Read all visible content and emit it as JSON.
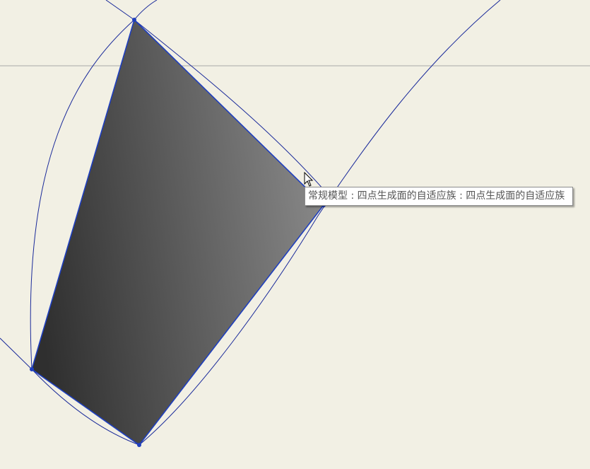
{
  "viewport": {
    "background": "#f2f0e4",
    "surface_fill_dark": "#2f2f2f",
    "surface_fill_light": "#8a8a8a",
    "edge_color": "#1f3fbf",
    "curve_color": "#1a2a9a",
    "reference_line_color": "#a8a8a8"
  },
  "tooltip": {
    "text": "常规模型 : 四点生成面的自适应族 : 四点生成面的自适应族"
  },
  "icons": {
    "cursor": "arrow-cursor-icon",
    "point": "adaptive-point-icon"
  }
}
